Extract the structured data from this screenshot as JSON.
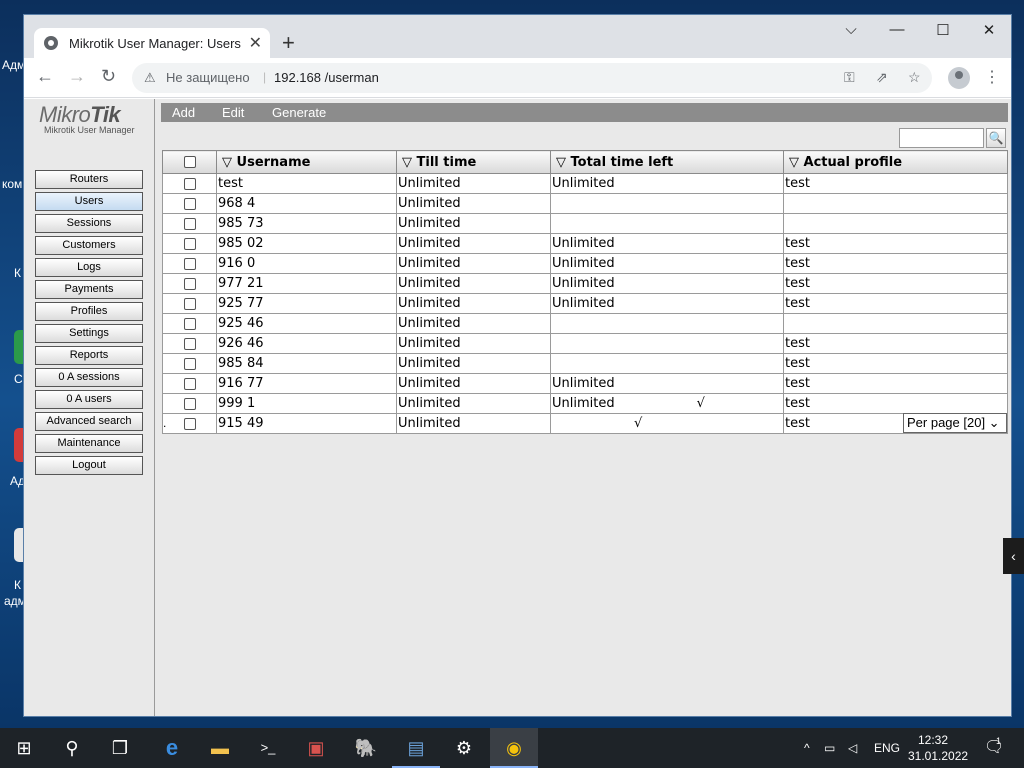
{
  "desktop": {
    "icon_labels": [
      "Адм",
      "ком",
      "К",
      "С",
      "Ад",
      "К",
      "адм"
    ]
  },
  "browser": {
    "tab_title": "Mikrotik User Manager: Users",
    "tab_close": "✕",
    "new_tab": "+",
    "window_controls": {
      "dropdown": "⌵",
      "minimize": "—",
      "maximize": "☐",
      "close": "✕"
    },
    "nav": {
      "back": "←",
      "forward": "→",
      "reload": "↻"
    },
    "security_label": "Не защищено",
    "url": "192.168        /userman"
  },
  "app": {
    "logo_brand_a": "Mikro",
    "logo_brand_b": "Tik",
    "logo_subtitle": "Mikrotik User Manager",
    "sidebar": [
      {
        "label": "Routers",
        "active": false
      },
      {
        "label": "Users",
        "active": true
      },
      {
        "label": "Sessions",
        "active": false
      },
      {
        "label": "Customers",
        "active": false
      },
      {
        "label": "Logs",
        "active": false
      },
      {
        "label": "Payments",
        "active": false
      },
      {
        "label": "Profiles",
        "active": false
      },
      {
        "label": "Settings",
        "active": false
      },
      {
        "label": "Reports",
        "active": false
      },
      {
        "label": "0 A sessions",
        "active": false
      },
      {
        "label": "0 A users",
        "active": false
      },
      {
        "label": "Advanced search",
        "active": false
      },
      {
        "label": "Maintenance",
        "active": false
      },
      {
        "label": "Logout",
        "active": false
      }
    ],
    "actions": {
      "add": "Add",
      "edit": "Edit",
      "generate": "Generate"
    },
    "search": {
      "placeholder": "",
      "button": "🔍"
    },
    "table": {
      "columns": [
        "▽ Username",
        "▽ Till time",
        "▽ Total time left",
        "▽ Actual profile"
      ],
      "rows": [
        {
          "username": "test",
          "till": "Unlimited",
          "left": "Unlimited",
          "profile": "test",
          "tick": ""
        },
        {
          "username": "968           4",
          "till": "Unlimited",
          "left": "",
          "profile": "",
          "tick": ""
        },
        {
          "username": "985          73",
          "till": "Unlimited",
          "left": "",
          "profile": "",
          "tick": ""
        },
        {
          "username": "985          02",
          "till": "Unlimited",
          "left": "Unlimited",
          "profile": "test",
          "tick": ""
        },
        {
          "username": "916           0",
          "till": "Unlimited",
          "left": "Unlimited",
          "profile": "test",
          "tick": ""
        },
        {
          "username": "977          21",
          "till": "Unlimited",
          "left": "Unlimited",
          "profile": "test",
          "tick": ""
        },
        {
          "username": "925          77",
          "till": "Unlimited",
          "left": "Unlimited",
          "profile": "test",
          "tick": ""
        },
        {
          "username": "925          46",
          "till": "Unlimited",
          "left": "",
          "profile": "",
          "tick": ""
        },
        {
          "username": "926          46",
          "till": "Unlimited",
          "left": "",
          "profile": "test",
          "tick": ""
        },
        {
          "username": "985          84",
          "till": "Unlimited",
          "left": "",
          "profile": "test",
          "tick": ""
        },
        {
          "username": "916          77",
          "till": "Unlimited",
          "left": "Unlimited",
          "profile": "test",
          "tick": ""
        },
        {
          "username": "999          1",
          "till": "Unlimited",
          "left": "Unlimited",
          "profile": "test",
          "tick": "√"
        },
        {
          "username": "915          49",
          "till": "Unlimited",
          "left": "",
          "profile": "test",
          "tick": "√"
        }
      ]
    },
    "per_page": "Per page [20] ⌄",
    "footer_dot": "."
  },
  "side_toggle": "‹",
  "taskbar": {
    "start": "⊞",
    "search": "⚲",
    "taskview": "❐",
    "apps": [
      "e",
      "▬",
      ">_",
      "▣",
      "🐘",
      "▤",
      "⚙",
      "◉"
    ],
    "tray_arrow": "^",
    "network": "▭",
    "volume": "◁",
    "language": "ENG",
    "time": "12:32",
    "date": "31.01.2022",
    "notifications": "1"
  },
  "colors": {
    "accent": "#8c8c8c",
    "active_nav": "#c5dbf1",
    "desktop": "#14508e"
  }
}
